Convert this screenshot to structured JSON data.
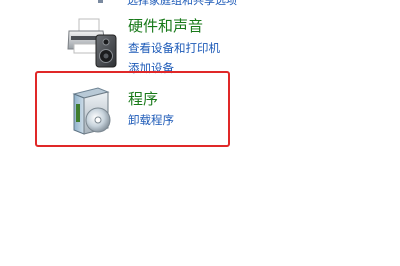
{
  "partial_link": "选择家庭组和共享选项",
  "hardware_and_sound": {
    "title": "硬件和声音",
    "links": [
      "查看设备和打印机",
      "添加设备"
    ],
    "icon": "printer-icon"
  },
  "programs": {
    "title": "程序",
    "links": [
      "卸载程序"
    ],
    "icon": "programs-box-icon"
  },
  "highlight_color": "#e02828"
}
